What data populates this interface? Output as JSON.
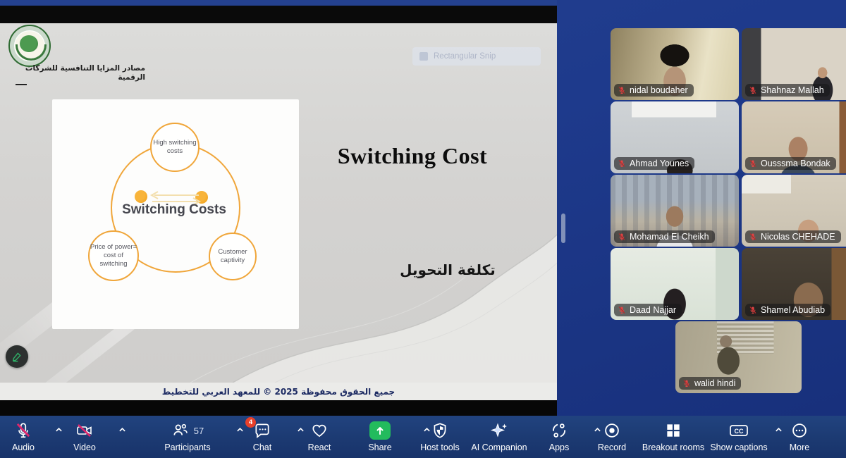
{
  "slide": {
    "header_title_ar": "مصادر المزايا التنافسية للشركات الرقمية",
    "title": "Switching Cost",
    "title_ar": "تكلفة التحويل",
    "footer_ar": "جميع الحقوق محفوظة 2025 © للمعهد العربي للتخطيط",
    "snip_ghost_label": "Rectangular Snip",
    "diagram": {
      "center": "Switching Costs",
      "top": "High switching costs",
      "bottom_left": "Price of power= cost of switching",
      "bottom_right": "Customer captivity"
    }
  },
  "participants": [
    {
      "name": "nidal boudaher",
      "muted": true
    },
    {
      "name": "Shahnaz Mallah",
      "muted": true
    },
    {
      "name": "Ahmad Younes",
      "muted": true
    },
    {
      "name": "Ousssma Bondak",
      "muted": true
    },
    {
      "name": "Mohamad El Cheikh",
      "muted": true
    },
    {
      "name": "Nicolas CHEHADE",
      "muted": true
    },
    {
      "name": "Daad Najjar",
      "muted": true
    },
    {
      "name": "Shamel Abudiab",
      "muted": true
    },
    {
      "name": "walid hindi",
      "muted": true
    }
  ],
  "toolbar": {
    "audio": "Audio",
    "video": "Video",
    "participants": "Participants",
    "participants_count": "57",
    "chat": "Chat",
    "chat_badge": "4",
    "react": "React",
    "share": "Share",
    "host_tools": "Host tools",
    "ai_companion": "AI Companion",
    "apps": "Apps",
    "record": "Record",
    "breakout_rooms": "Breakout rooms",
    "show_captions": "Show captions",
    "more": "More"
  },
  "colors": {
    "panel_blue": "#1E3A8C",
    "toolbar_blue": "#1C3A72",
    "share_green": "#23BB5D",
    "slash_pink": "#E0266C",
    "badge_red": "#E8402A",
    "diagram_orange": "#F0A63A",
    "mute_red": "#E04545"
  }
}
